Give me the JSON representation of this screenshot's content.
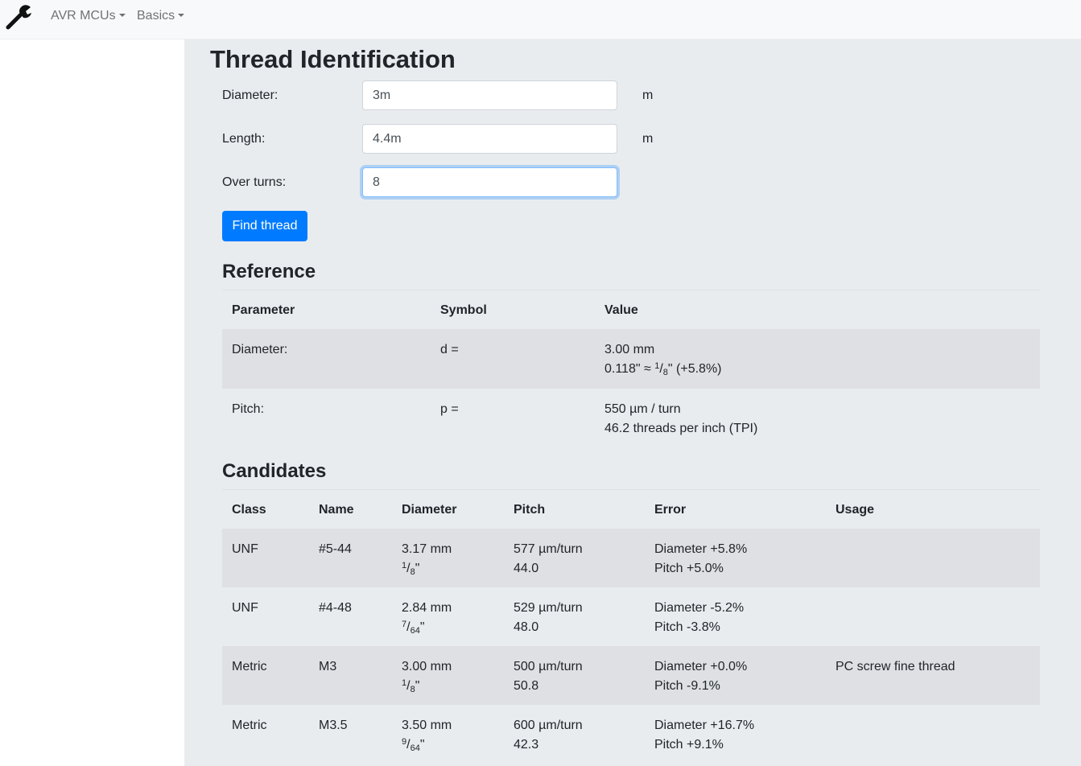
{
  "nav": {
    "brand_icon": "wrench-icon",
    "items": [
      {
        "label": "AVR MCUs"
      },
      {
        "label": "Basics"
      }
    ]
  },
  "page": {
    "title": "Thread Identification"
  },
  "form": {
    "diameter": {
      "label": "Diameter:",
      "value": "3m",
      "unit": "m"
    },
    "length": {
      "label": "Length:",
      "value": "4.4m",
      "unit": "m"
    },
    "over_turns": {
      "label": "Over turns:",
      "value": "8"
    },
    "submit_label": "Find thread"
  },
  "reference": {
    "title": "Reference",
    "headers": [
      "Parameter",
      "Symbol",
      "Value"
    ],
    "rows": [
      {
        "parameter": "Diameter:",
        "symbol": "d =",
        "value1": "3.00 mm",
        "value2_pre": "0.118\" ≈ ",
        "frac_num": "1",
        "frac_den": "8",
        "value2_post": "\" (+5.8%)"
      },
      {
        "parameter": "Pitch:",
        "symbol": "p =",
        "value1": "550 µm / turn",
        "value2": "46.2 threads per inch (TPI)"
      }
    ]
  },
  "candidates": {
    "title": "Candidates",
    "headers": [
      "Class",
      "Name",
      "Diameter",
      "Pitch",
      "Error",
      "Usage"
    ],
    "rows": [
      {
        "class": "UNF",
        "name": "#5-44",
        "diameter_mm": "3.17 mm",
        "frac_num": "1",
        "frac_den": "8",
        "pitch": "577 µm/turn",
        "tpi": "44.0",
        "diameter_error": "Diameter +5.8%",
        "pitch_error": "Pitch +5.0%",
        "usage": ""
      },
      {
        "class": "UNF",
        "name": "#4-48",
        "diameter_mm": "2.84 mm",
        "frac_num": "7",
        "frac_den": "64",
        "pitch": "529 µm/turn",
        "tpi": "48.0",
        "diameter_error": "Diameter -5.2%",
        "pitch_error": "Pitch -3.8%",
        "usage": ""
      },
      {
        "class": "Metric",
        "name": "M3",
        "diameter_mm": "3.00 mm",
        "frac_num": "1",
        "frac_den": "8",
        "pitch": "500 µm/turn",
        "tpi": "50.8",
        "diameter_error": "Diameter +0.0%",
        "pitch_error": "Pitch -9.1%",
        "usage": "PC screw fine thread"
      },
      {
        "class": "Metric",
        "name": "M3.5",
        "diameter_mm": "3.50 mm",
        "frac_num": "9",
        "frac_den": "64",
        "pitch": "600 µm/turn",
        "tpi": "42.3",
        "diameter_error": "Diameter +16.7%",
        "pitch_error": "Pitch +9.1%",
        "usage": ""
      }
    ]
  }
}
